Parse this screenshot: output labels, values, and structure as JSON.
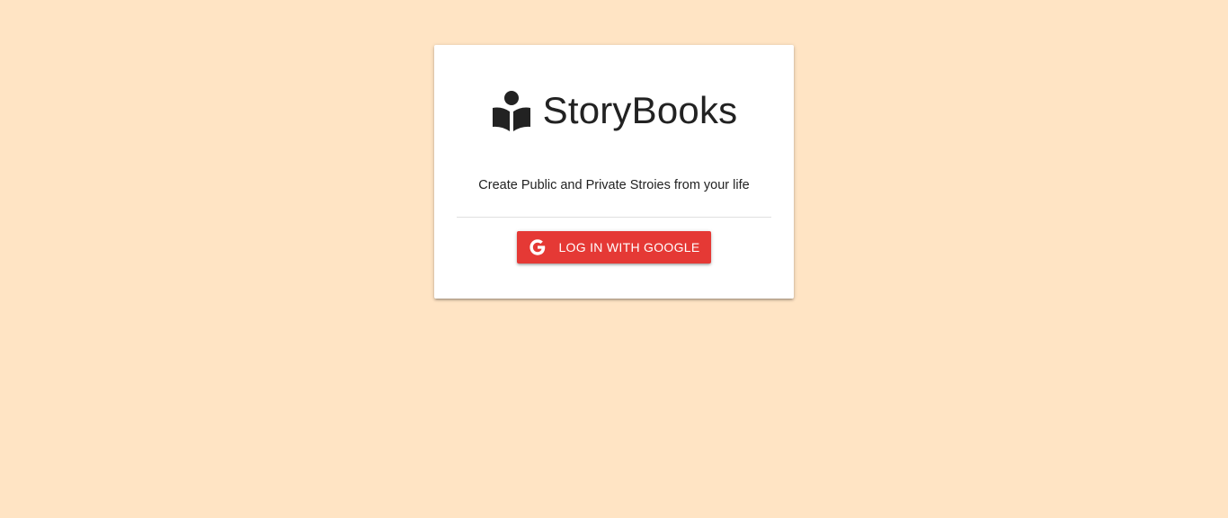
{
  "colors": {
    "background": "#ffe4c4",
    "card": "#ffffff",
    "button": "#e53935",
    "text": "#222222"
  },
  "brand": {
    "icon": "book-reader-icon",
    "title": "StoryBooks"
  },
  "tagline": "Create Public and Private Stroies from your life",
  "login": {
    "icon": "google-icon",
    "label": "LOG IN WITH GOOGLE"
  }
}
